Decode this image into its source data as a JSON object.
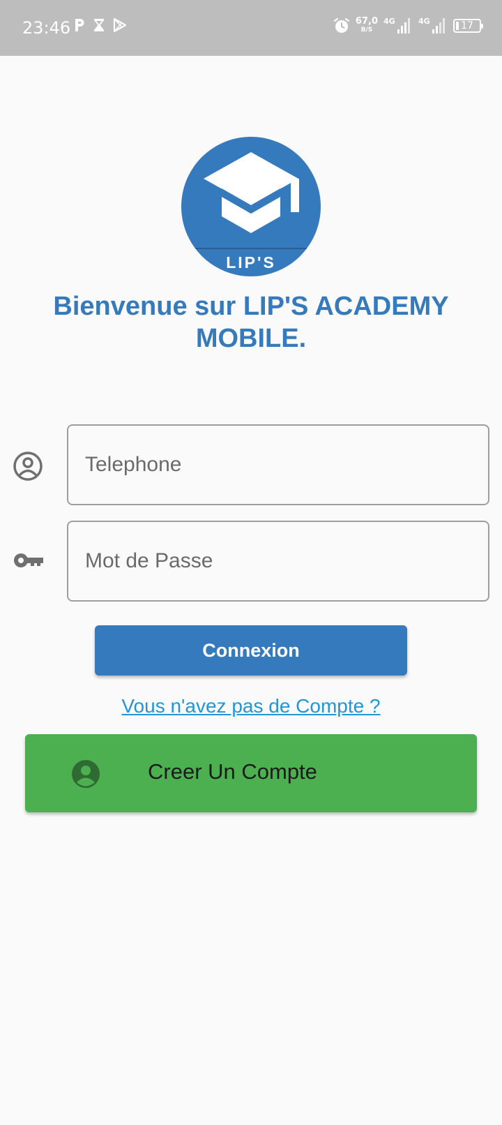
{
  "status_bar": {
    "time": "23:46",
    "net_speed_value": "67,0",
    "net_speed_unit": "B/S",
    "signal1_label": "4G",
    "signal2_label": "4G",
    "battery_level": "17"
  },
  "logo": {
    "text": "LIP'S",
    "icon": "graduation-cap-icon",
    "color": "#357abd"
  },
  "welcome": {
    "title": "Bienvenue sur LIP'S ACADEMY MOBILE."
  },
  "form": {
    "phone_placeholder": "Telephone",
    "password_placeholder": "Mot de Passe",
    "phone_icon": "account-circle-icon",
    "password_icon": "key-icon"
  },
  "login": {
    "label": "Connexion",
    "color": "#357abd"
  },
  "signup": {
    "link_text": "Vous n'avez pas de Compte ?",
    "button_label": "Creer Un Compte",
    "button_icon": "account-circle-icon",
    "color": "#4caf50"
  }
}
